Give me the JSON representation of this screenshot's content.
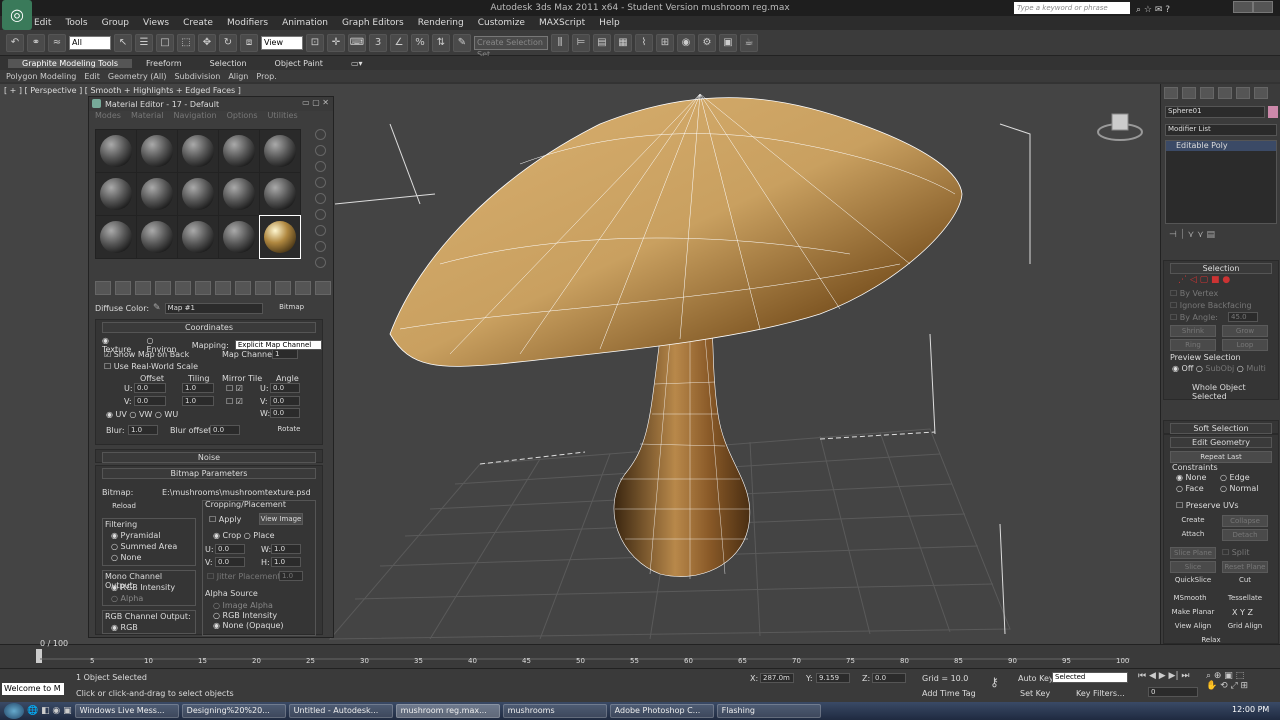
{
  "app": {
    "title": "Autodesk 3ds Max 2011 x64 - Student Version   mushroom reg.max",
    "search_placeholder": "Type a keyword or phrase"
  },
  "menu": [
    "Edit",
    "Tools",
    "Group",
    "Views",
    "Create",
    "Modifiers",
    "Animation",
    "Graph Editors",
    "Rendering",
    "Customize",
    "MAXScript",
    "Help"
  ],
  "toolbar": {
    "selection_filter": "All",
    "view_dropdown": "View",
    "named_selection": "Create Selection Set"
  },
  "ribbon": {
    "tabs": [
      "Graphite Modeling Tools",
      "Freeform",
      "Selection",
      "Object Paint"
    ],
    "subtabs": [
      "Polygon Modeling",
      "Edit",
      "Geometry (All)",
      "Subdivision",
      "Align",
      "Prop."
    ]
  },
  "viewport": {
    "label": "[ + ] [ Perspective ] [ Smooth + Highlights + Edged Faces ]"
  },
  "material_editor": {
    "title": "Material Editor - 17 - Default",
    "menu": [
      "Modes",
      "Material",
      "Navigation",
      "Options",
      "Utilities"
    ],
    "diffuse_label": "Diffuse Color:",
    "map_name": "Map #1",
    "map_type": "Bitmap",
    "coordinates": {
      "header": "Coordinates",
      "texture": "Texture",
      "environ": "Environ",
      "mapping_label": "Mapping:",
      "mapping_value": "Explicit Map Channel",
      "show_map": "Show Map on Back",
      "map_channel_label": "Map Channel:",
      "map_channel": "1",
      "real_world": "Use Real-World Scale",
      "offset": "Offset",
      "tiling": "Tiling",
      "mirror_tile": "Mirror Tile",
      "angle": "Angle",
      "u": "U:",
      "v": "V:",
      "w": "W:",
      "u_offset": "0.0",
      "v_offset": "0.0",
      "u_tiling": "1.0",
      "v_tiling": "1.0",
      "u_angle": "0.0",
      "v_angle": "0.0",
      "w_angle": "0.0",
      "uv": "UV",
      "vw": "VW",
      "wu": "WU",
      "blur_label": "Blur:",
      "blur": "1.0",
      "blur_offset_label": "Blur offset:",
      "blur_offset": "0.0",
      "rotate": "Rotate"
    },
    "noise_header": "Noise",
    "bitmap": {
      "header": "Bitmap Parameters",
      "bitmap_label": "Bitmap:",
      "path": "E:\\mushrooms\\mushroomtexture.psd",
      "reload": "Reload",
      "cropping": "Cropping/Placement",
      "apply": "Apply",
      "view_image": "View Image",
      "crop": "Crop",
      "place": "Place",
      "u": "U:",
      "v": "V:",
      "w": "W:",
      "h": "H:",
      "u_val": "0.0",
      "v_val": "0.0",
      "w_val": "1.0",
      "h_val": "1.0",
      "jitter": "Jitter Placement:",
      "jitter_val": "1.0",
      "filtering": "Filtering",
      "pyramidal": "Pyramidal",
      "summed": "Summed Area",
      "none": "None",
      "mono": "Mono Channel Output:",
      "rgb_int": "RGB Intensity",
      "alpha": "Alpha",
      "rgb_channel": "RGB Channel Output:",
      "rgb": "RGB",
      "alpha_source": "Alpha Source",
      "image_alpha": "Image Alpha",
      "rgb_intensity2": "RGB Intensity",
      "none_opaque": "None (Opaque)"
    }
  },
  "command_panel": {
    "object_name": "Sphere01",
    "modifier_list": "Modifier List",
    "stack_item": "Editable Poly",
    "selection_header": "Selection",
    "by_vertex": "By Vertex",
    "ignore_backfacing": "Ignore Backfacing",
    "by_angle": "By Angle:",
    "angle_val": "45.0",
    "shrink": "Shrink",
    "grow": "Grow",
    "ring": "Ring",
    "loop": "Loop",
    "preview": "Preview Selection",
    "off": "Off",
    "subobj": "SubObj",
    "multi": "Multi",
    "whole_selected": "Whole Object Selected",
    "soft_selection": "Soft Selection",
    "edit_geometry": "Edit Geometry",
    "repeat_last": "Repeat Last",
    "constraints": "Constraints",
    "c_none": "None",
    "c_edge": "Edge",
    "c_face": "Face",
    "c_normal": "Normal",
    "preserve_uvs": "Preserve UVs",
    "create": "Create",
    "collapse": "Collapse",
    "attach": "Attach",
    "detach": "Detach",
    "slice_plane": "Slice Plane",
    "split": "Split",
    "slice": "Slice",
    "reset_plane": "Reset Plane",
    "quickslice": "QuickSlice",
    "cut": "Cut",
    "msmooth": "MSmooth",
    "tessellate": "Tessellate",
    "make_planar": "Make Planar",
    "x": "X",
    "y": "Y",
    "z": "Z",
    "view_align": "View Align",
    "grid_align": "Grid Align",
    "relax": "Relax"
  },
  "timeline": {
    "frame": "0 / 100",
    "ticks": [
      "5",
      "10",
      "15",
      "20",
      "25",
      "30",
      "35",
      "40",
      "45",
      "50",
      "55",
      "60",
      "65",
      "70",
      "75",
      "80",
      "85",
      "90",
      "95",
      "100"
    ]
  },
  "status": {
    "welcome": "Welcome to M",
    "selected": "1 Object Selected",
    "prompt": "Click or click-and-drag to select objects",
    "x_label": "X:",
    "x_val": "287.0m",
    "y_label": "Y:",
    "y_val": "9.159",
    "z_label": "Z:",
    "z_val": "0.0",
    "grid": "Grid = 10.0",
    "auto_key": "Auto Key",
    "set_key": "Set Key",
    "selected_dd": "Selected",
    "key_filters": "Key Filters...",
    "add_time_tag": "Add Time Tag",
    "frame_val": "0"
  },
  "taskbar": {
    "items": [
      "Windows Live Mess...",
      "Designing%20%20...",
      "Untitled - Autodesk...",
      "mushroom reg.max...",
      "mushrooms",
      "Adobe Photoshop C...",
      "Flashing"
    ],
    "clock": "12:00 PM"
  }
}
